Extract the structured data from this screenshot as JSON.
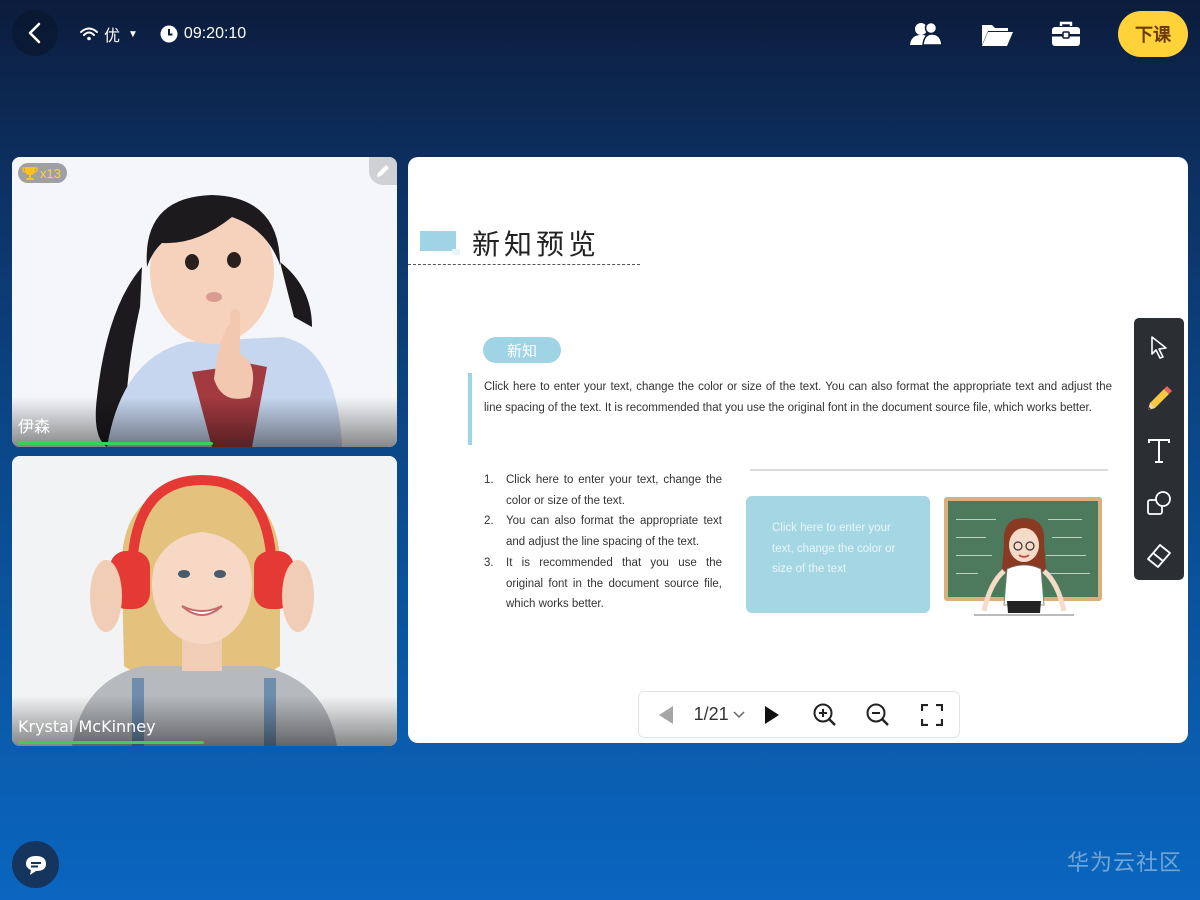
{
  "status": {
    "network_quality": "优",
    "time": "09:20:10"
  },
  "header": {
    "end_class_label": "下课",
    "icons": [
      "users-icon",
      "folder-icon",
      "toolbox-icon"
    ]
  },
  "participants": [
    {
      "name": "伊森",
      "trophy_count": "x13",
      "audio_level": 0.5
    },
    {
      "name": "Krystal McKinney",
      "audio_level": 0.48
    }
  ],
  "slide": {
    "title": "新知预览",
    "tag": "新知",
    "paragraph": "Click here to enter your text, change the color or size of the text. You can also format the appropriate text and adjust the line spacing of the text. It is recommended that you use the original font in the document source file, which works better.",
    "list": [
      {
        "num": "1.",
        "text": "Click here to enter your text, change the color or size of the text."
      },
      {
        "num": "2.",
        "text": "You can also format the appropriate text and adjust the line spacing of the text."
      },
      {
        "num": "3.",
        "text": "It is recommended that you use the original font in the document source file, which works better."
      }
    ],
    "box_text": "Click here to enter your text, change the color or size of the text"
  },
  "pager": {
    "page": "1/21"
  },
  "tools": [
    "pointer-tool-icon",
    "pencil-tool-icon",
    "text-tool-icon",
    "shape-tool-icon",
    "eraser-tool-icon"
  ],
  "watermark": "华为云社区",
  "colors": {
    "accent_yellow": "#ffd23a",
    "slide_accent": "#9fd4e4",
    "audio_green": "#38d05a"
  }
}
